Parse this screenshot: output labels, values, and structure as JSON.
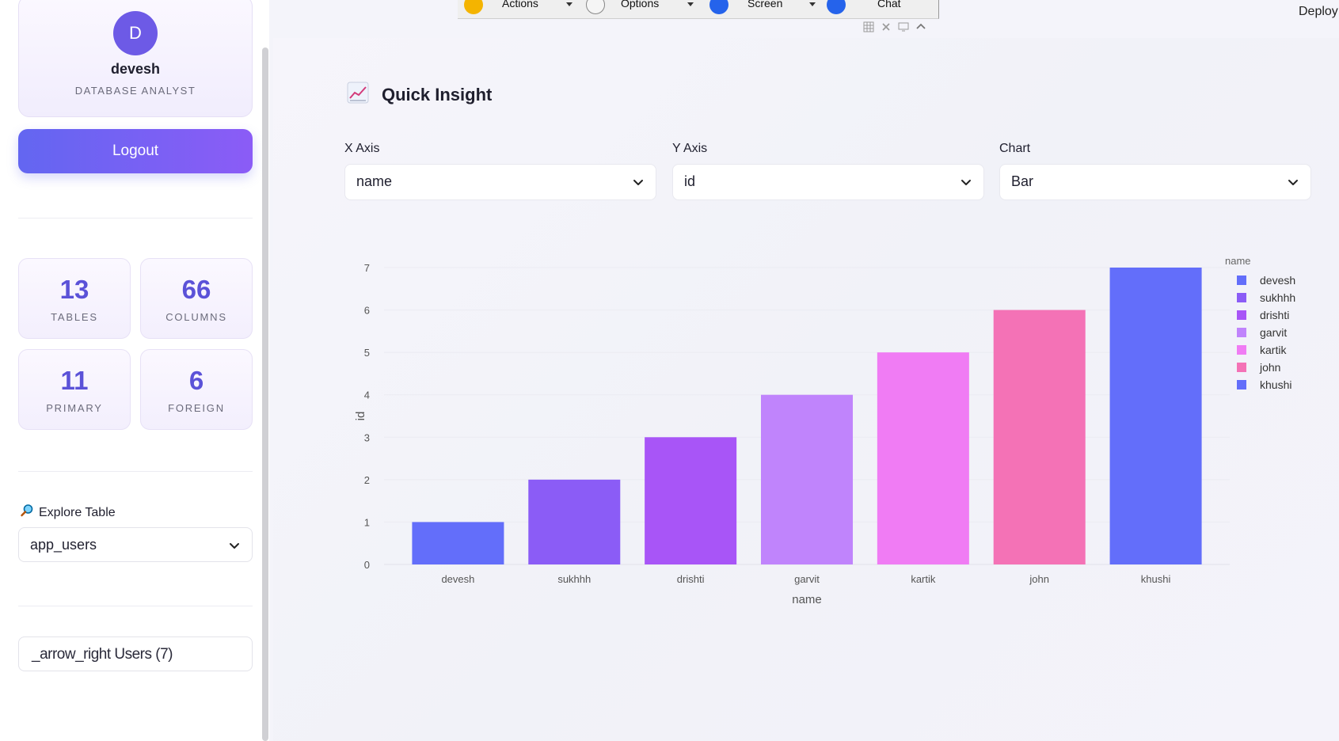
{
  "sidebar": {
    "avatar_initial": "D",
    "user_name": "devesh",
    "user_role": "DATABASE ANALYST",
    "logout_label": "Logout",
    "stats": [
      {
        "value": "13",
        "label": "TABLES"
      },
      {
        "value": "66",
        "label": "COLUMNS"
      },
      {
        "value": "11",
        "label": "PRIMARY"
      },
      {
        "value": "6",
        "label": "FOREIGN"
      }
    ],
    "explore_label": "Explore Table",
    "explore_value": "app_users",
    "expander_text": "_arrow_right Users (7)"
  },
  "toolbar": {
    "actions_label": "Actions",
    "options_label": "Options",
    "screen_label": "Screen",
    "chat_label": "Chat",
    "deploy_label": "Deploy"
  },
  "main": {
    "title": "Quick Insight",
    "x_axis": {
      "label": "X Axis",
      "value": "name"
    },
    "y_axis": {
      "label": "Y Axis",
      "value": "id"
    },
    "chart_select": {
      "label": "Chart",
      "value": "Bar"
    }
  },
  "chart_data": {
    "type": "bar",
    "title": "",
    "xlabel": "name",
    "ylabel": "id",
    "categories": [
      "devesh",
      "sukhhh",
      "drishti",
      "garvit",
      "kartik",
      "john",
      "khushi"
    ],
    "values": [
      1,
      2,
      3,
      4,
      5,
      6,
      7
    ],
    "colors": [
      "#636efa",
      "#8b5cf6",
      "#a855f7",
      "#c084fc",
      "#f07cf4",
      "#f472b6",
      "#636efa"
    ],
    "ylim": [
      0,
      7
    ],
    "yticks": [
      0,
      1,
      2,
      3,
      4,
      5,
      6,
      7
    ],
    "legend": {
      "title": "name",
      "placement": "top-right"
    },
    "grid": true
  }
}
